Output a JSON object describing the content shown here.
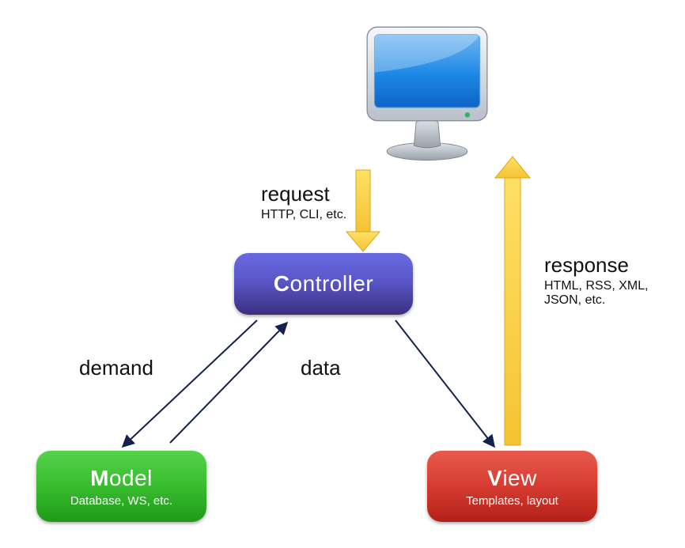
{
  "nodes": {
    "controller": {
      "initial": "C",
      "rest": "ontroller"
    },
    "model": {
      "initial": "M",
      "rest": "odel",
      "sub": "Database, WS, etc."
    },
    "view": {
      "initial": "V",
      "rest": "iew",
      "sub": "Templates, layout"
    }
  },
  "labels": {
    "request": {
      "title": "request",
      "sub": "HTTP, CLI, etc."
    },
    "response": {
      "title": "response",
      "sub": "HTML, RSS, XML, JSON, etc."
    },
    "demand": "demand",
    "data": "data"
  },
  "icons": {
    "client": "monitor-icon"
  }
}
